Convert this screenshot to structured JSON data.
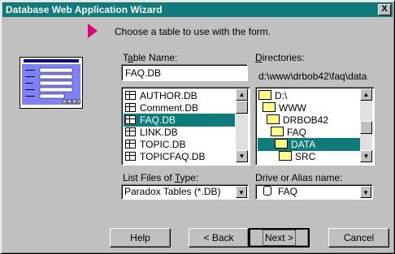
{
  "window": {
    "title": "Database Web Application Wizard",
    "close_label": "X"
  },
  "instruction": "Choose a table to use with the form.",
  "table_name": {
    "label_prefix": "T",
    "label_underlined": "a",
    "label_suffix": "ble Name:",
    "value": "FAQ.DB"
  },
  "files": [
    {
      "name": "AUTHOR.DB",
      "selected": false
    },
    {
      "name": "Comment.DB",
      "selected": false
    },
    {
      "name": "FAQ.DB",
      "selected": true
    },
    {
      "name": "LINK.DB",
      "selected": false
    },
    {
      "name": "TOPIC.DB",
      "selected": false
    },
    {
      "name": "TOPICFAQ.DB",
      "selected": false
    }
  ],
  "directories": {
    "label_underlined": "D",
    "label_suffix": "irectories:",
    "current_path": "d:\\www\\drbob42\\faq\\data",
    "items": [
      {
        "name": "D:\\"
      },
      {
        "name": "WWW"
      },
      {
        "name": "DRBOB42"
      },
      {
        "name": "FAQ"
      },
      {
        "name": "DATA",
        "selected": true
      },
      {
        "name": "SRC"
      }
    ]
  },
  "file_type": {
    "label_prefix": "List Files of ",
    "label_underlined": "T",
    "label_suffix": "ype:",
    "value": "Paradox Tables (*.DB)"
  },
  "drive": {
    "label": "Drive or Alias name:",
    "value": "FAQ"
  },
  "buttons": {
    "help": "Help",
    "back": "< Back",
    "next": "Next >",
    "cancel": "Cancel"
  }
}
